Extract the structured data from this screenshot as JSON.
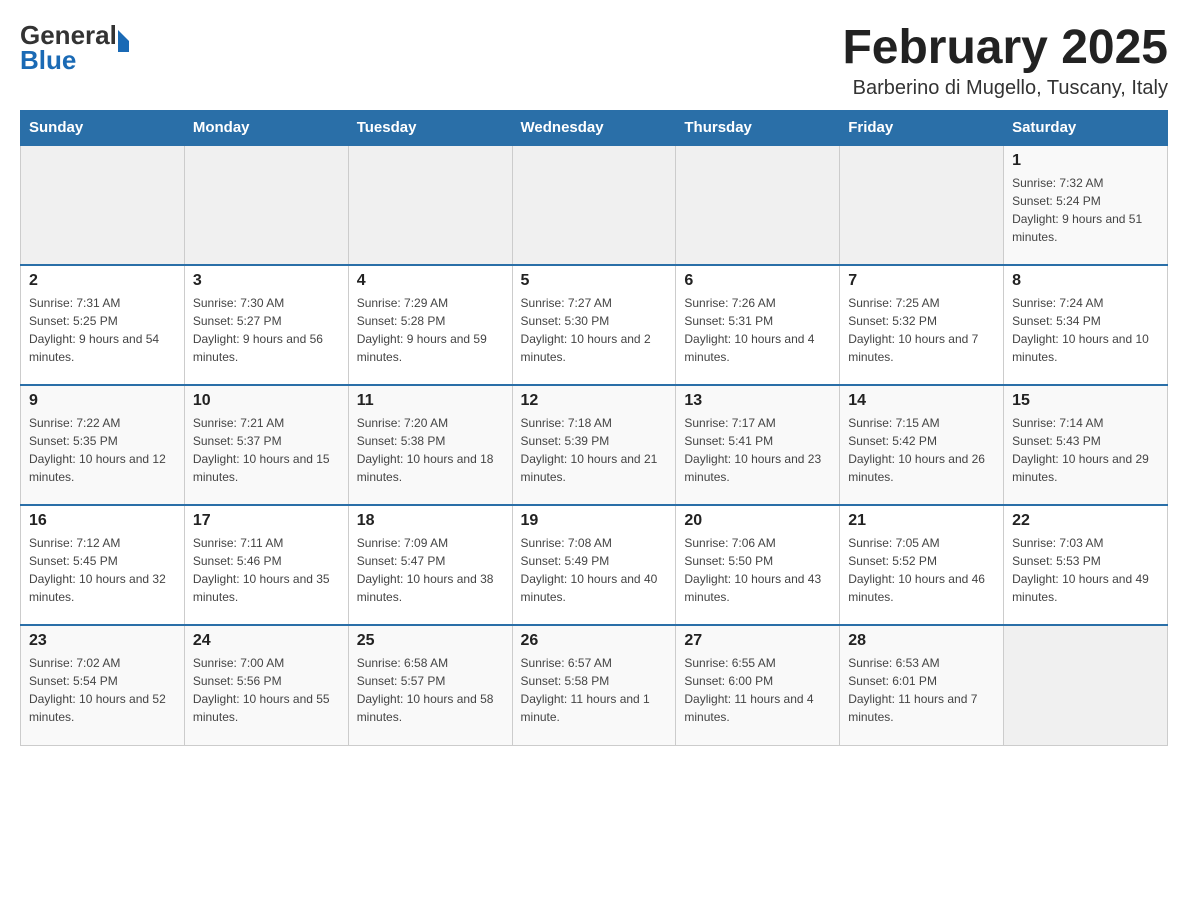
{
  "header": {
    "logo_general": "General",
    "logo_blue": "Blue",
    "month_title": "February 2025",
    "location": "Barberino di Mugello, Tuscany, Italy"
  },
  "days_of_week": [
    "Sunday",
    "Monday",
    "Tuesday",
    "Wednesday",
    "Thursday",
    "Friday",
    "Saturday"
  ],
  "weeks": [
    [
      {
        "day": "",
        "info": ""
      },
      {
        "day": "",
        "info": ""
      },
      {
        "day": "",
        "info": ""
      },
      {
        "day": "",
        "info": ""
      },
      {
        "day": "",
        "info": ""
      },
      {
        "day": "",
        "info": ""
      },
      {
        "day": "1",
        "info": "Sunrise: 7:32 AM\nSunset: 5:24 PM\nDaylight: 9 hours and 51 minutes."
      }
    ],
    [
      {
        "day": "2",
        "info": "Sunrise: 7:31 AM\nSunset: 5:25 PM\nDaylight: 9 hours and 54 minutes."
      },
      {
        "day": "3",
        "info": "Sunrise: 7:30 AM\nSunset: 5:27 PM\nDaylight: 9 hours and 56 minutes."
      },
      {
        "day": "4",
        "info": "Sunrise: 7:29 AM\nSunset: 5:28 PM\nDaylight: 9 hours and 59 minutes."
      },
      {
        "day": "5",
        "info": "Sunrise: 7:27 AM\nSunset: 5:30 PM\nDaylight: 10 hours and 2 minutes."
      },
      {
        "day": "6",
        "info": "Sunrise: 7:26 AM\nSunset: 5:31 PM\nDaylight: 10 hours and 4 minutes."
      },
      {
        "day": "7",
        "info": "Sunrise: 7:25 AM\nSunset: 5:32 PM\nDaylight: 10 hours and 7 minutes."
      },
      {
        "day": "8",
        "info": "Sunrise: 7:24 AM\nSunset: 5:34 PM\nDaylight: 10 hours and 10 minutes."
      }
    ],
    [
      {
        "day": "9",
        "info": "Sunrise: 7:22 AM\nSunset: 5:35 PM\nDaylight: 10 hours and 12 minutes."
      },
      {
        "day": "10",
        "info": "Sunrise: 7:21 AM\nSunset: 5:37 PM\nDaylight: 10 hours and 15 minutes."
      },
      {
        "day": "11",
        "info": "Sunrise: 7:20 AM\nSunset: 5:38 PM\nDaylight: 10 hours and 18 minutes."
      },
      {
        "day": "12",
        "info": "Sunrise: 7:18 AM\nSunset: 5:39 PM\nDaylight: 10 hours and 21 minutes."
      },
      {
        "day": "13",
        "info": "Sunrise: 7:17 AM\nSunset: 5:41 PM\nDaylight: 10 hours and 23 minutes."
      },
      {
        "day": "14",
        "info": "Sunrise: 7:15 AM\nSunset: 5:42 PM\nDaylight: 10 hours and 26 minutes."
      },
      {
        "day": "15",
        "info": "Sunrise: 7:14 AM\nSunset: 5:43 PM\nDaylight: 10 hours and 29 minutes."
      }
    ],
    [
      {
        "day": "16",
        "info": "Sunrise: 7:12 AM\nSunset: 5:45 PM\nDaylight: 10 hours and 32 minutes."
      },
      {
        "day": "17",
        "info": "Sunrise: 7:11 AM\nSunset: 5:46 PM\nDaylight: 10 hours and 35 minutes."
      },
      {
        "day": "18",
        "info": "Sunrise: 7:09 AM\nSunset: 5:47 PM\nDaylight: 10 hours and 38 minutes."
      },
      {
        "day": "19",
        "info": "Sunrise: 7:08 AM\nSunset: 5:49 PM\nDaylight: 10 hours and 40 minutes."
      },
      {
        "day": "20",
        "info": "Sunrise: 7:06 AM\nSunset: 5:50 PM\nDaylight: 10 hours and 43 minutes."
      },
      {
        "day": "21",
        "info": "Sunrise: 7:05 AM\nSunset: 5:52 PM\nDaylight: 10 hours and 46 minutes."
      },
      {
        "day": "22",
        "info": "Sunrise: 7:03 AM\nSunset: 5:53 PM\nDaylight: 10 hours and 49 minutes."
      }
    ],
    [
      {
        "day": "23",
        "info": "Sunrise: 7:02 AM\nSunset: 5:54 PM\nDaylight: 10 hours and 52 minutes."
      },
      {
        "day": "24",
        "info": "Sunrise: 7:00 AM\nSunset: 5:56 PM\nDaylight: 10 hours and 55 minutes."
      },
      {
        "day": "25",
        "info": "Sunrise: 6:58 AM\nSunset: 5:57 PM\nDaylight: 10 hours and 58 minutes."
      },
      {
        "day": "26",
        "info": "Sunrise: 6:57 AM\nSunset: 5:58 PM\nDaylight: 11 hours and 1 minute."
      },
      {
        "day": "27",
        "info": "Sunrise: 6:55 AM\nSunset: 6:00 PM\nDaylight: 11 hours and 4 minutes."
      },
      {
        "day": "28",
        "info": "Sunrise: 6:53 AM\nSunset: 6:01 PM\nDaylight: 11 hours and 7 minutes."
      },
      {
        "day": "",
        "info": ""
      }
    ]
  ]
}
